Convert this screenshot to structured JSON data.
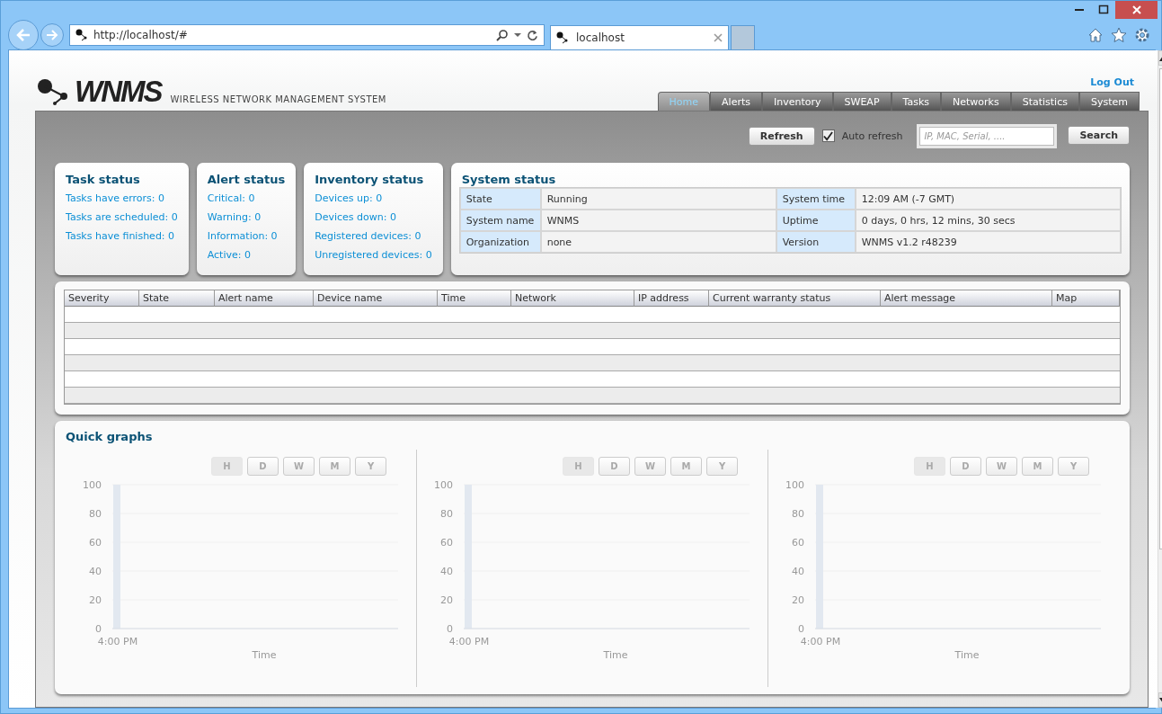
{
  "browser": {
    "address": "http://localhost/#",
    "tab_title": "localhost"
  },
  "header": {
    "logo_text": "WNMS",
    "subtitle": "WIRELESS NETWORK MANAGEMENT SYSTEM",
    "logout": "Log Out"
  },
  "nav_tabs": [
    {
      "label": "Home",
      "selected": true
    },
    {
      "label": "Alerts",
      "selected": false
    },
    {
      "label": "Inventory",
      "selected": false
    },
    {
      "label": "SWEAP",
      "selected": false
    },
    {
      "label": "Tasks",
      "selected": false
    },
    {
      "label": "Networks",
      "selected": false
    },
    {
      "label": "Statistics",
      "selected": false
    },
    {
      "label": "System",
      "selected": false
    }
  ],
  "toolbar": {
    "refresh": "Refresh",
    "auto_refresh": {
      "label": "Auto refresh",
      "checked": true
    },
    "search": {
      "placeholder": "IP, MAC, Serial, ...."
    },
    "search_button": "Search"
  },
  "status_cards": [
    {
      "title": "Task status",
      "items": [
        "Tasks have errors: 0",
        "Tasks are scheduled: 0",
        "Tasks have finished: 0"
      ]
    },
    {
      "title": "Alert status",
      "items": [
        "Critical: 0",
        "Warning: 0",
        "Information: 0",
        "Active: 0"
      ]
    },
    {
      "title": "Inventory status",
      "items": [
        "Devices up: 0",
        "Devices down: 0",
        "Registered devices: 0",
        "Unregistered devices: 0"
      ]
    }
  ],
  "system_status": {
    "title": "System status",
    "rows": [
      [
        {
          "label": "State",
          "value": "Running"
        },
        {
          "label": "System time",
          "value": "12:09 AM  (-7 GMT)"
        }
      ],
      [
        {
          "label": "System name",
          "value": "WNMS"
        },
        {
          "label": "Uptime",
          "value": "0 days,  0 hrs,  12 mins,  30 secs"
        }
      ],
      [
        {
          "label": "Organization",
          "value": "none"
        },
        {
          "label": "Version",
          "value": "WNMS v1.2 r48239"
        }
      ]
    ]
  },
  "alerts_table": {
    "columns": [
      "Severity",
      "State",
      "Alert name",
      "Device name",
      "Time",
      "Network",
      "IP address",
      "Current warranty status",
      "Alert message",
      "Map"
    ]
  },
  "quick_graphs": {
    "title": "Quick graphs",
    "graphs": [
      {
        "ranges": [
          {
            "label": "H",
            "selected": true
          },
          {
            "label": "D",
            "selected": false
          },
          {
            "label": "W",
            "selected": false
          },
          {
            "label": "M",
            "selected": false
          },
          {
            "label": "Y",
            "selected": false
          }
        ],
        "chart_data": {
          "type": "bar",
          "categories": [
            "4:00 PM"
          ],
          "series": [
            {
              "color": "#e2e8f0",
              "values": [
                100
              ]
            }
          ],
          "ylim": [
            0,
            100
          ],
          "yticks": [
            0,
            20,
            40,
            60,
            80,
            100
          ]
        },
        "axis_title": "Time"
      },
      {
        "ranges": [
          {
            "label": "H",
            "selected": true
          },
          {
            "label": "D",
            "selected": false
          },
          {
            "label": "W",
            "selected": false
          },
          {
            "label": "M",
            "selected": false
          },
          {
            "label": "Y",
            "selected": false
          }
        ],
        "chart_data": {
          "type": "bar",
          "categories": [
            "4:00 PM"
          ],
          "series": [
            {
              "color": "#e2e8f0",
              "values": [
                100
              ]
            }
          ],
          "ylim": [
            0,
            100
          ],
          "yticks": [
            0,
            20,
            40,
            60,
            80,
            100
          ]
        },
        "axis_title": "Time"
      },
      {
        "ranges": [
          {
            "label": "H",
            "selected": true
          },
          {
            "label": "D",
            "selected": false
          },
          {
            "label": "W",
            "selected": false
          },
          {
            "label": "M",
            "selected": false
          },
          {
            "label": "Y",
            "selected": false
          }
        ],
        "chart_data": {
          "type": "bar",
          "categories": [
            "4:00 PM"
          ],
          "series": [
            {
              "color": "#e2e8f0",
              "values": [
                100
              ]
            }
          ],
          "ylim": [
            0,
            100
          ],
          "yticks": [
            0,
            20,
            40,
            60,
            80,
            100
          ]
        },
        "axis_title": "Time"
      }
    ]
  }
}
